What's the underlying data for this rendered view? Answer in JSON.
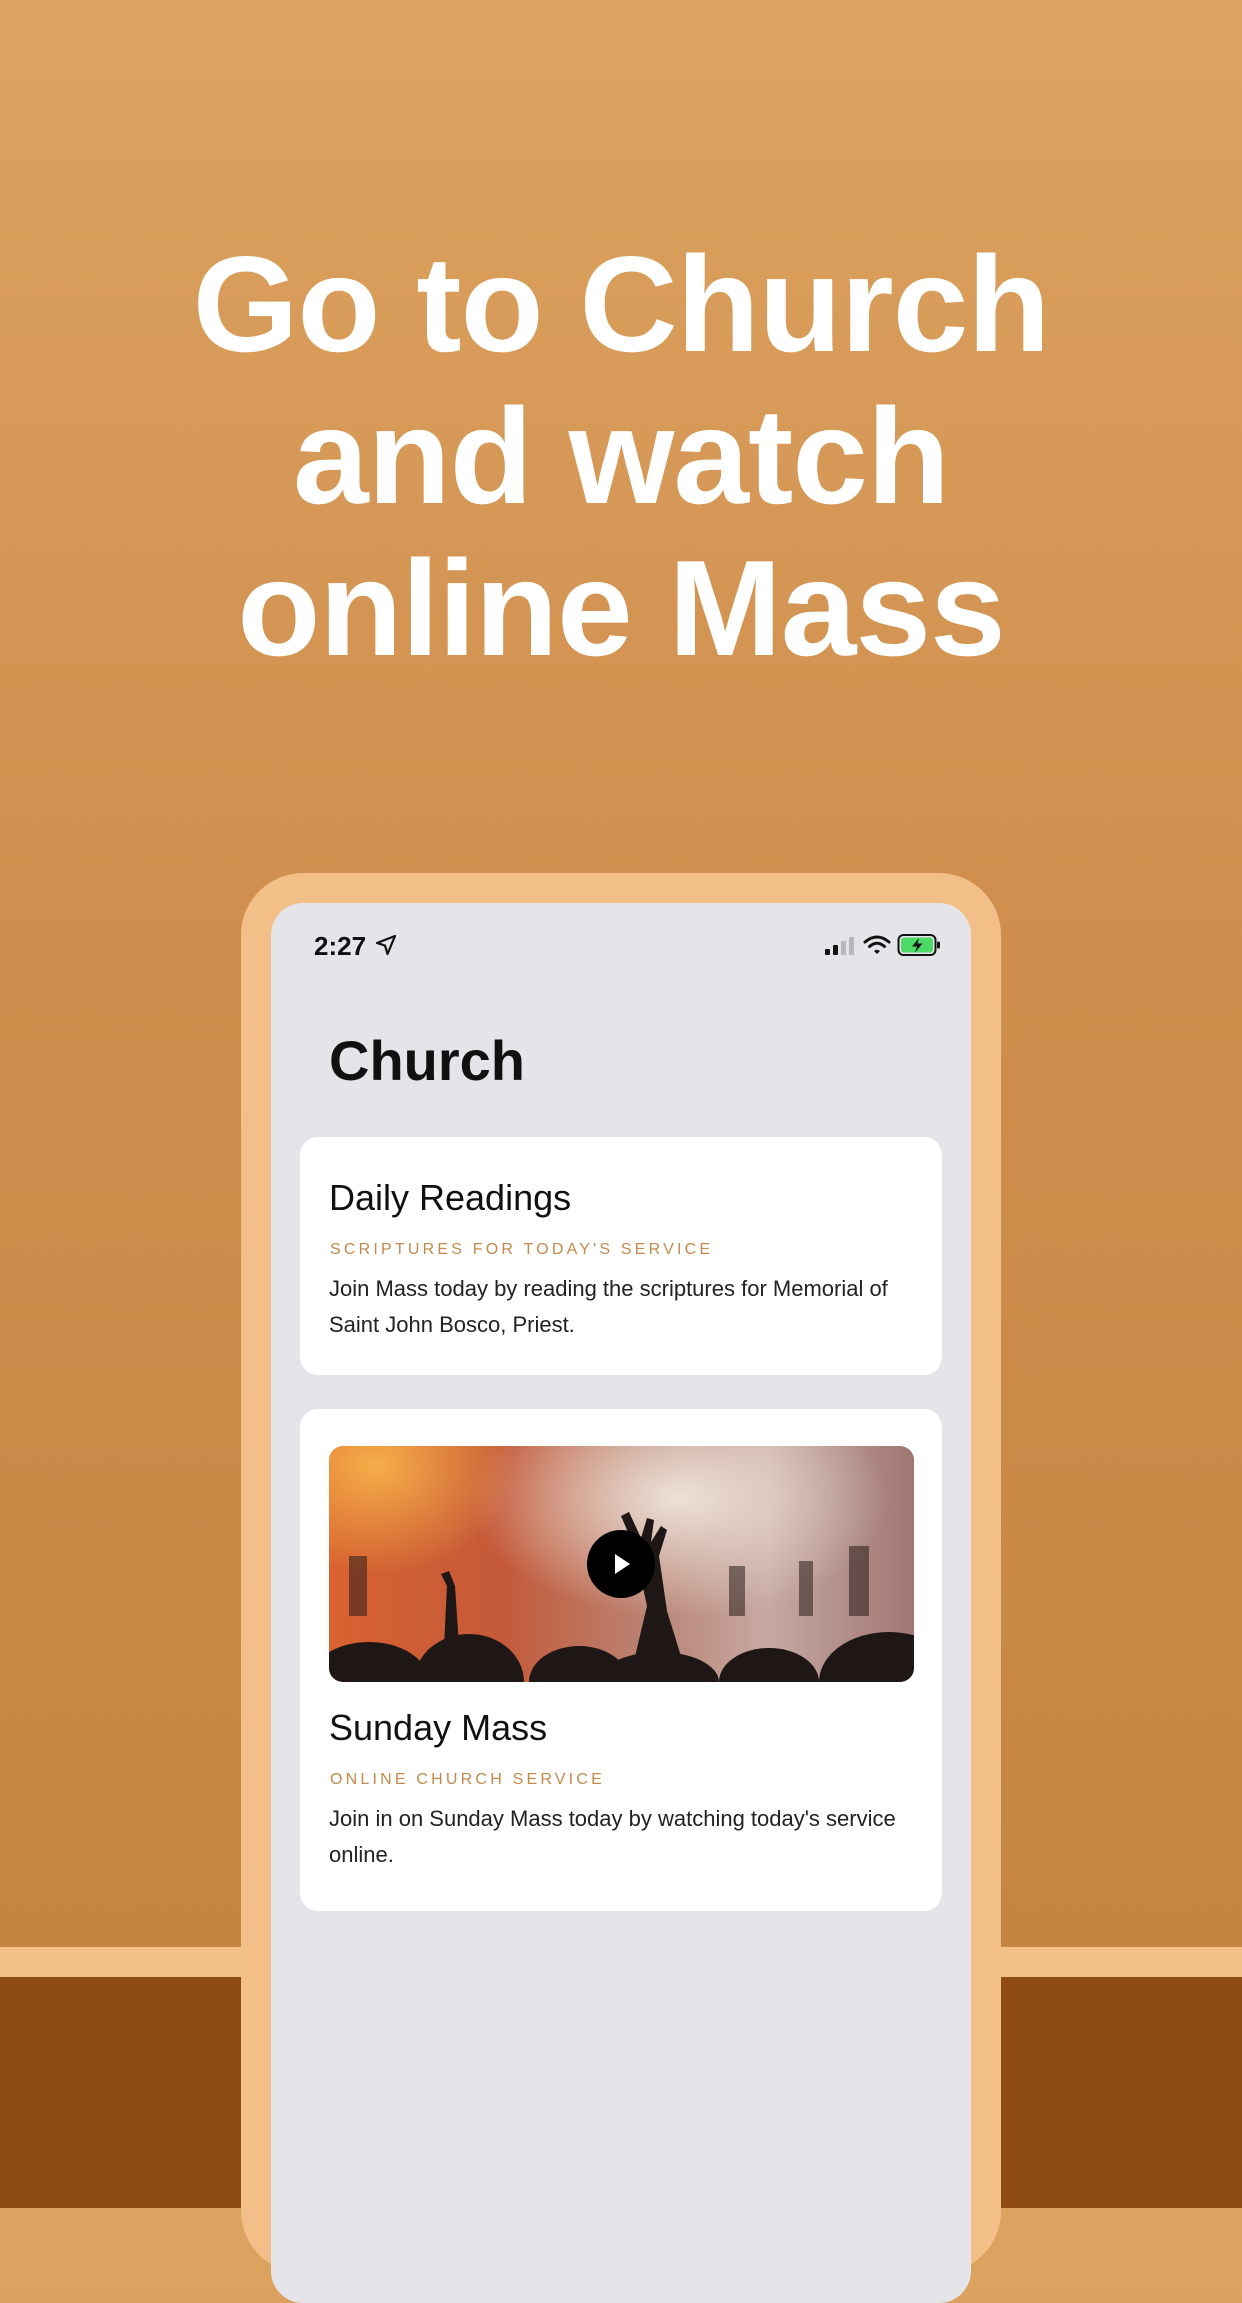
{
  "headline": {
    "line1": "Go to Church",
    "line2": "and watch",
    "line3": "online Mass"
  },
  "status_bar": {
    "time": "2:27",
    "icons": [
      "location-arrow-icon",
      "cellular-signal-icon",
      "wifi-icon",
      "battery-charging-icon"
    ]
  },
  "page": {
    "title": "Church"
  },
  "cards": [
    {
      "title": "Daily Readings",
      "subtitle": "SCRIPTURES FOR TODAY'S SERVICE",
      "body": "Join Mass today by reading the scriptures for Memorial of Saint John Bosco, Priest."
    },
    {
      "title": "Sunday Mass",
      "subtitle": "ONLINE CHURCH SERVICE",
      "body": "Join in on Sunday Mass today by watching today's service online.",
      "media": {
        "icon": "play-icon"
      }
    }
  ],
  "colors": {
    "background_top": "#DDA360",
    "background_bottom": "#C2823F",
    "phone_frame": "#F2BF88",
    "floor": "#8F4B14",
    "screen": "#E4E4E9",
    "subtitle_accent": "#C28A4C",
    "battery_green": "#4CD964"
  }
}
